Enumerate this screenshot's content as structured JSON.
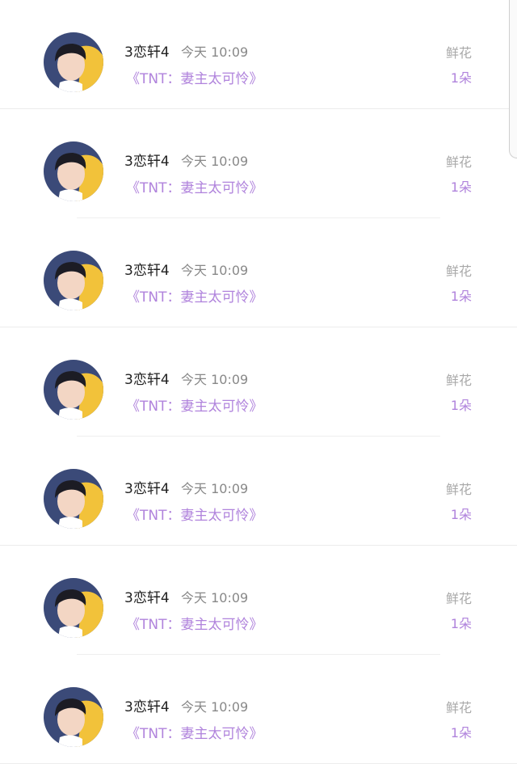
{
  "gifts": [
    {
      "user": "3恋轩4",
      "time": "今天 10:09",
      "book": "《TNT：妻主太可怜》",
      "gift_type": "鲜花",
      "gift_count": "1朵"
    },
    {
      "user": "3恋轩4",
      "time": "今天 10:09",
      "book": "《TNT：妻主太可怜》",
      "gift_type": "鲜花",
      "gift_count": "1朵"
    },
    {
      "user": "3恋轩4",
      "time": "今天 10:09",
      "book": "《TNT：妻主太可怜》",
      "gift_type": "鲜花",
      "gift_count": "1朵"
    },
    {
      "user": "3恋轩4",
      "time": "今天 10:09",
      "book": "《TNT：妻主太可怜》",
      "gift_type": "鲜花",
      "gift_count": "1朵"
    },
    {
      "user": "3恋轩4",
      "time": "今天 10:09",
      "book": "《TNT：妻主太可怜》",
      "gift_type": "鲜花",
      "gift_count": "1朵"
    },
    {
      "user": "3恋轩4",
      "time": "今天 10:09",
      "book": "《TNT：妻主太可怜》",
      "gift_type": "鲜花",
      "gift_count": "1朵"
    },
    {
      "user": "3恋轩4",
      "time": "今天 10:09",
      "book": "《TNT：妻主太可怜》",
      "gift_type": "鲜花",
      "gift_count": "1朵"
    }
  ],
  "colors": {
    "accent": "#b083dc",
    "name_text": "#222222",
    "meta_text": "#888888",
    "gift_label": "#a9a9a9"
  }
}
